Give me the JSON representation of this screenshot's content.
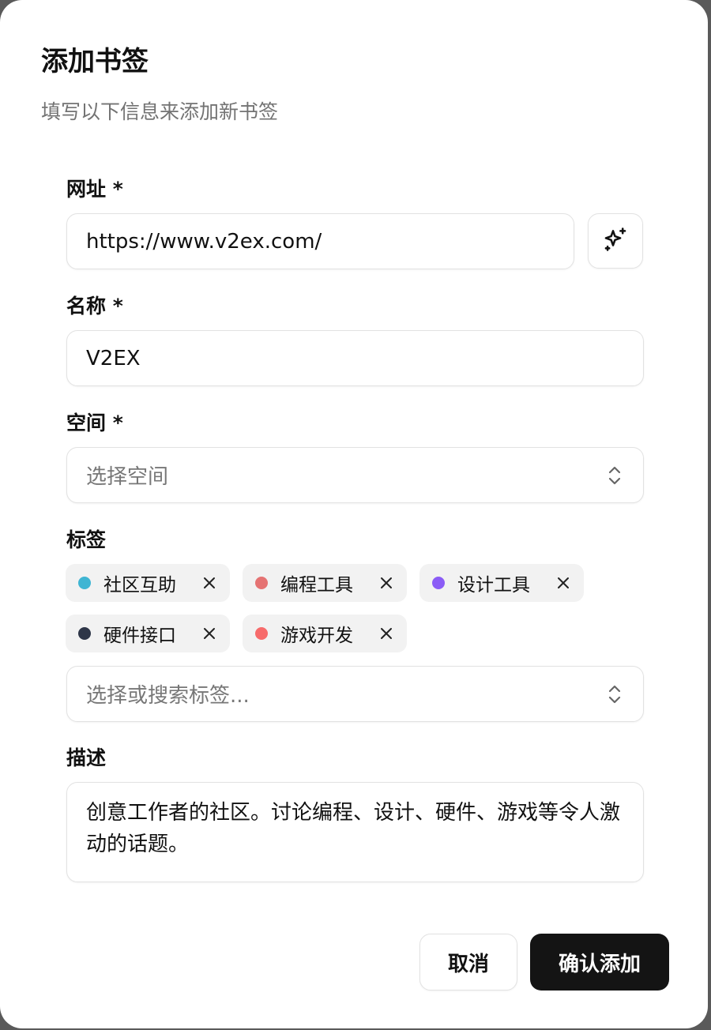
{
  "dialog": {
    "title": "添加书签",
    "subtitle": "填写以下信息来添加新书签"
  },
  "form": {
    "url": {
      "label": "网址 *",
      "value": "https://www.v2ex.com/",
      "ai_icon": "sparkles-icon"
    },
    "name": {
      "label": "名称 *",
      "value": "V2EX"
    },
    "space": {
      "label": "空间 *",
      "placeholder": "选择空间",
      "icon": "chevrons-up-down-icon"
    },
    "tags": {
      "label": "标签",
      "selected": [
        {
          "label": "社区互助",
          "color": "#3fb5d3"
        },
        {
          "label": "编程工具",
          "color": "#e57373"
        },
        {
          "label": "设计工具",
          "color": "#8b5cf6"
        },
        {
          "label": "硬件接口",
          "color": "#2e3648"
        },
        {
          "label": "游戏开发",
          "color": "#f76b6b"
        }
      ],
      "placeholder": "选择或搜索标签...",
      "remove_icon": "close-icon"
    },
    "description": {
      "label": "描述",
      "value": "创意工作者的社区。讨论编程、设计、硬件、游戏等令人激动的话题。"
    }
  },
  "actions": {
    "cancel_label": "取消",
    "confirm_label": "确认添加"
  }
}
